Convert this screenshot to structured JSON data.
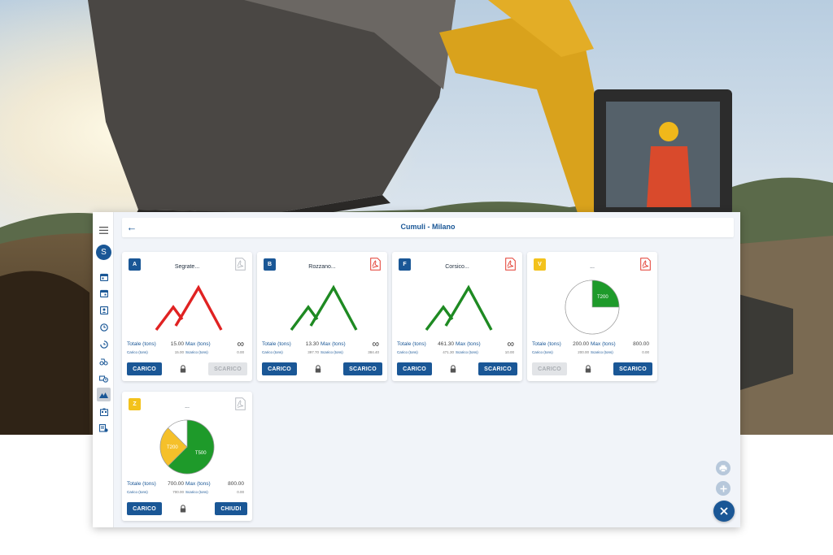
{
  "app": {
    "title": "Cumuli - Milano",
    "user_initial": "S",
    "accent": "#1a5796"
  },
  "sidebar": {
    "items": [
      {
        "icon": "calendar-icon"
      },
      {
        "icon": "calendar-alt-icon"
      },
      {
        "icon": "contact-card-icon"
      },
      {
        "icon": "clock-icon"
      },
      {
        "icon": "history-icon"
      },
      {
        "icon": "transport-icon"
      },
      {
        "icon": "truck-clock-icon"
      },
      {
        "icon": "piles-icon",
        "active": true
      },
      {
        "icon": "building-icon"
      },
      {
        "icon": "report-settings-icon"
      }
    ]
  },
  "labels": {
    "totale": "Totale (tons)",
    "max": "Max (tons)",
    "carico": "Carico (tons)",
    "scarico": "Scarico (tons)"
  },
  "cards": [
    {
      "code": "A",
      "name": "Segrate...",
      "totale": "15.00",
      "max": "∞",
      "carico": "15.00",
      "scarico": "0.00",
      "btn_left": "CARICO",
      "btn_right": "SCARICO",
      "mountain_color": "#e02222"
    },
    {
      "code": "B",
      "name": "Rozzano...",
      "totale": "13.30",
      "max": "∞",
      "carico": "397.70",
      "scarico": "384.40",
      "btn_left": "CARICO",
      "btn_right": "SCARICO",
      "mountain_color": "#1e8a22"
    },
    {
      "code": "F",
      "name": "Corsico...",
      "totale": "461.30",
      "max": "∞",
      "carico": "471.30",
      "scarico": "10.00",
      "btn_left": "CARICO",
      "btn_right": "SCARICO",
      "mountain_color": "#1e8a22"
    },
    {
      "code": "V",
      "name": "...",
      "totale": "200.00",
      "max": "800.00",
      "carico": "200.00",
      "scarico": "0.00",
      "btn_left": "CARICO",
      "btn_right": "SCARICO",
      "pie": [
        {
          "label": "T200",
          "value": 200,
          "color": "#1e9a2a"
        },
        {
          "label": "",
          "value": 600,
          "color": "#ffffff"
        }
      ]
    },
    {
      "code": "Z",
      "name": "...",
      "totale": "700.00",
      "max": "800.00",
      "carico": "700.00",
      "scarico": "0.00",
      "btn_left": "CARICO",
      "btn_right": "CHIUDI",
      "pie": [
        {
          "label": "T500",
          "value": 500,
          "color": "#1e9a2a"
        },
        {
          "label": "T200",
          "value": 200,
          "color": "#f5c02a"
        },
        {
          "label": "",
          "value": 100,
          "color": "#ffffff"
        }
      ]
    }
  ],
  "fabs": {
    "print": "print-icon",
    "add": "add-icon",
    "close": "close-icon"
  }
}
